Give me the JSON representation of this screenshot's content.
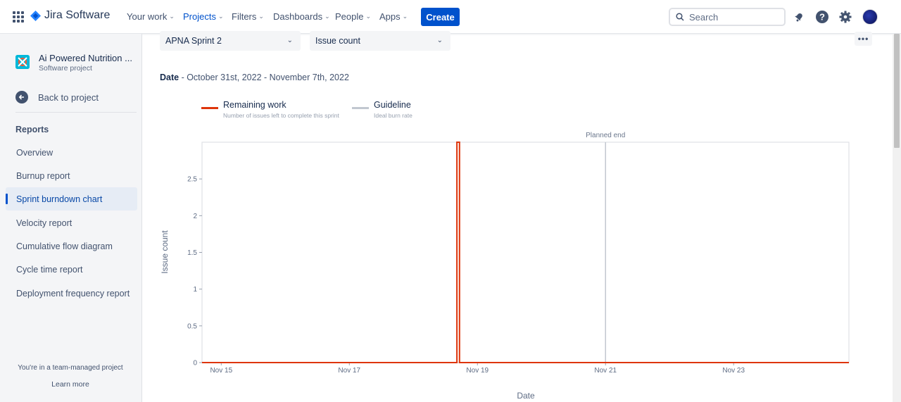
{
  "topnav": {
    "brand": "Jira Software",
    "items": [
      {
        "label": "Your work"
      },
      {
        "label": "Projects"
      },
      {
        "label": "Filters"
      },
      {
        "label": "Dashboards"
      },
      {
        "label": "People"
      },
      {
        "label": "Apps"
      }
    ],
    "create_label": "Create",
    "search_placeholder": "Search",
    "brand_color": "#0052CC"
  },
  "sidebar": {
    "project_name": "Ai Powered Nutrition ...",
    "project_type": "Software project",
    "back_label": "Back to project",
    "section_heading": "Reports",
    "items": [
      {
        "label": "Overview"
      },
      {
        "label": "Burnup report"
      },
      {
        "label": "Sprint burndown chart"
      },
      {
        "label": "Velocity report"
      },
      {
        "label": "Cumulative flow diagram"
      },
      {
        "label": "Cycle time report"
      },
      {
        "label": "Deployment frequency report"
      }
    ],
    "active_item": "Sprint burndown chart",
    "footer_note": "You're in a team-managed project",
    "footer_link": "Learn more"
  },
  "main": {
    "sprint_select": "APNA Sprint 2",
    "metric_select": "Issue count",
    "date_label": "Date",
    "date_range": " - October 31st, 2022 - November 7th, 2022",
    "legend": [
      {
        "title": "Remaining work",
        "desc": "Number of issues left to complete this sprint",
        "color": "#DE350B"
      },
      {
        "title": "Guideline",
        "desc": "Ideal burn rate",
        "color": "#C1C7D0"
      }
    ]
  },
  "chart_data": {
    "type": "line",
    "xlabel": "Date",
    "ylabel": "Issue count",
    "x_ticks": [
      "Nov 15",
      "Nov 17",
      "Nov 19",
      "Nov 21",
      "Nov 23"
    ],
    "y_ticks": [
      "0",
      "0.5",
      "1",
      "1.5",
      "2",
      "2.5"
    ],
    "xlim": [
      "Nov 14.7",
      "Nov 24.8"
    ],
    "ylim": [
      0,
      3
    ],
    "annotation": "Planned end",
    "planned_end_x": "Nov 21",
    "series": [
      {
        "name": "Remaining work",
        "color": "#DE350B",
        "points": [
          {
            "x": 14.7,
            "y": 0
          },
          {
            "x": 18.68,
            "y": 0
          },
          {
            "x": 18.68,
            "y": 3
          },
          {
            "x": 18.72,
            "y": 3
          },
          {
            "x": 18.72,
            "y": 0
          },
          {
            "x": 24.8,
            "y": 0
          }
        ]
      }
    ]
  }
}
